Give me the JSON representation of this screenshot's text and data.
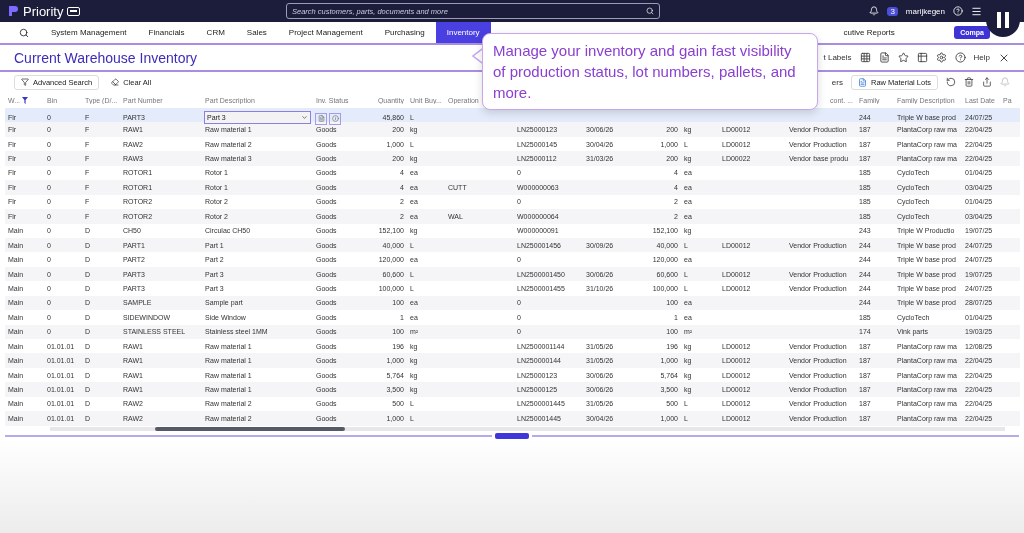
{
  "topbar": {
    "brand": "Priority",
    "search": {
      "placeholder": "Search customers, parts, documents and more"
    },
    "notifications": "3",
    "user": "marijkegen"
  },
  "nav": {
    "items": [
      {
        "label": "System Management",
        "selected": false
      },
      {
        "label": "Financials",
        "selected": false
      },
      {
        "label": "CRM",
        "selected": false
      },
      {
        "label": "Sales",
        "selected": false
      },
      {
        "label": "Project Management",
        "selected": false
      },
      {
        "label": "Purchasing",
        "selected": false
      },
      {
        "label": "Inventory",
        "selected": true
      }
    ],
    "trailing": "cutive Reports",
    "button": "Compa"
  },
  "form": {
    "title": "Current Warehouse Inventory",
    "labels_button": "t Labels",
    "help": "Help"
  },
  "filters": {
    "advanced_search": "Advanced Search",
    "clear_all": "Clear All",
    "partial_button": "ers",
    "lots_button": "Raw Material Lots"
  },
  "tooltip": {
    "text": "Manage your inventory and gain fast visibility of production status, lot numbers, pallets, and more."
  },
  "table": {
    "columns": [
      "W...",
      "Bin",
      "Type (D/...",
      "Part Number",
      "Part Description",
      "Inv. Status",
      "Quantity",
      "Unit Buy...",
      "Operation",
      null,
      null,
      null,
      null,
      null,
      "cont. ...",
      "Family",
      "Family Description",
      "Last Date",
      "Pa"
    ],
    "rows": [
      {
        "selected": true,
        "kind": "editing",
        "cells": [
          "Flr",
          "0",
          "F",
          "PART3",
          "Part 3",
          null,
          "45,860",
          "L",
          null,
          null,
          null,
          null,
          null,
          null,
          null,
          "244",
          "Triple W base prod",
          "24/07/25"
        ]
      },
      {
        "selected": false,
        "kind": "plain",
        "cells": [
          "Flr",
          "0",
          "F",
          "RAW1",
          "Raw material 1",
          "Goods",
          "200",
          "kg",
          null,
          "LN25000123",
          "30/06/26",
          "200",
          "kg",
          "LD00012",
          "Vendor Production",
          "187",
          "PlantaCorp raw ma",
          "22/04/25"
        ]
      },
      {
        "selected": false,
        "kind": "plain",
        "cells": [
          "Flr",
          "0",
          "F",
          "RAW2",
          "Raw material 2",
          "Goods",
          "1,000",
          "L",
          null,
          "LN25000145",
          "30/04/26",
          "1,000",
          "L",
          "LD00012",
          "Vendor Production",
          "187",
          "PlantaCorp raw ma",
          "22/04/25"
        ]
      },
      {
        "selected": false,
        "kind": "plain",
        "cells": [
          "Flr",
          "0",
          "F",
          "RAW3",
          "Raw material 3",
          "Goods",
          "200",
          "kg",
          null,
          "LN25000112",
          "31/03/26",
          "200",
          "kg",
          "LD00022",
          "Vendor base produ",
          "187",
          "PlantaCorp raw ma",
          "22/04/25"
        ]
      },
      {
        "selected": false,
        "kind": "plain",
        "cells": [
          "Flr",
          "0",
          "F",
          "ROTOR1",
          "Rotor 1",
          "Goods",
          "4",
          "ea",
          null,
          "0",
          null,
          "4",
          "ea",
          null,
          null,
          "185",
          "CycloTech",
          "01/04/25"
        ]
      },
      {
        "selected": false,
        "kind": "plain",
        "cells": [
          "Flr",
          "0",
          "F",
          "ROTOR1",
          "Rotor 1",
          "Goods",
          "4",
          "ea",
          "CUTT",
          "W000000063",
          null,
          "4",
          "ea",
          null,
          null,
          "185",
          "CycloTech",
          "03/04/25"
        ]
      },
      {
        "selected": false,
        "kind": "plain",
        "cells": [
          "Flr",
          "0",
          "F",
          "ROTOR2",
          "Rotor 2",
          "Goods",
          "2",
          "ea",
          null,
          "0",
          null,
          "2",
          "ea",
          null,
          null,
          "185",
          "CycloTech",
          "01/04/25"
        ]
      },
      {
        "selected": false,
        "kind": "plain",
        "cells": [
          "Flr",
          "0",
          "F",
          "ROTOR2",
          "Rotor 2",
          "Goods",
          "2",
          "ea",
          "WAL",
          "W000000064",
          null,
          "2",
          "ea",
          null,
          null,
          "185",
          "CycloTech",
          "03/04/25"
        ]
      },
      {
        "selected": false,
        "kind": "plain",
        "cells": [
          "Main",
          "0",
          "D",
          "CH50",
          "Circulac CH50",
          "Goods",
          "152,100",
          "kg",
          null,
          "W000000091",
          null,
          "152,100",
          "kg",
          null,
          null,
          "243",
          "Triple W Productio",
          "19/07/25"
        ]
      },
      {
        "selected": false,
        "kind": "plain",
        "cells": [
          "Main",
          "0",
          "D",
          "PART1",
          "Part 1",
          "Goods",
          "40,000",
          "L",
          null,
          "LN250001456",
          "30/09/26",
          "40,000",
          "L",
          "LD00012",
          "Vendor Production",
          "244",
          "Triple W base prod",
          "24/07/25"
        ]
      },
      {
        "selected": false,
        "kind": "plain",
        "cells": [
          "Main",
          "0",
          "D",
          "PART2",
          "Part 2",
          "Goods",
          "120,000",
          "ea",
          null,
          "0",
          null,
          "120,000",
          "ea",
          null,
          null,
          "244",
          "Triple W base prod",
          "24/07/25"
        ]
      },
      {
        "selected": false,
        "kind": "plain",
        "cells": [
          "Main",
          "0",
          "D",
          "PART3",
          "Part 3",
          "Goods",
          "60,600",
          "L",
          null,
          "LN2500001450",
          "30/06/26",
          "60,600",
          "L",
          "LD00012",
          "Vendor Production",
          "244",
          "Triple W base prod",
          "19/07/25"
        ]
      },
      {
        "selected": false,
        "kind": "plain",
        "cells": [
          "Main",
          "0",
          "D",
          "PART3",
          "Part 3",
          "Goods",
          "100,000",
          "L",
          null,
          "LN2500001455",
          "31/10/26",
          "100,000",
          "L",
          "LD00012",
          "Vendor Production",
          "244",
          "Triple W base prod",
          "24/07/25"
        ]
      },
      {
        "selected": false,
        "kind": "plain",
        "cells": [
          "Main",
          "0",
          "D",
          "SAMPLE",
          "Sample part",
          "Goods",
          "100",
          "ea",
          null,
          "0",
          null,
          "100",
          "ea",
          null,
          null,
          "244",
          "Triple W base prod",
          "28/07/25"
        ]
      },
      {
        "selected": false,
        "kind": "plain",
        "cells": [
          "Main",
          "0",
          "D",
          "SIDEWINDOW",
          "Side Window",
          "Goods",
          "1",
          "ea",
          null,
          "0",
          null,
          "1",
          "ea",
          null,
          null,
          "185",
          "CycloTech",
          "01/04/25"
        ]
      },
      {
        "selected": false,
        "kind": "plain",
        "cells": [
          "Main",
          "0",
          "D",
          "STAINLESS STEEL",
          "Stainless steel 1MM",
          "Goods",
          "100",
          "m²",
          null,
          "0",
          null,
          "100",
          "m²",
          null,
          null,
          "174",
          "Vink parts",
          "19/03/25"
        ]
      },
      {
        "selected": false,
        "kind": "plain",
        "cells": [
          "Main",
          "01.01.01",
          "D",
          "RAW1",
          "Raw material 1",
          "Goods",
          "196",
          "kg",
          null,
          "LN2500001144",
          "31/05/26",
          "196",
          "kg",
          "LD00012",
          "Vendor Production",
          "187",
          "PlantaCorp raw ma",
          "12/08/25"
        ]
      },
      {
        "selected": false,
        "kind": "plain",
        "cells": [
          "Main",
          "01.01.01",
          "D",
          "RAW1",
          "Raw material 1",
          "Goods",
          "1,000",
          "kg",
          null,
          "LN250000144",
          "31/05/26",
          "1,000",
          "kg",
          "LD00012",
          "Vendor Production",
          "187",
          "PlantaCorp raw ma",
          "22/04/25"
        ]
      },
      {
        "selected": false,
        "kind": "plain",
        "cells": [
          "Main",
          "01.01.01",
          "D",
          "RAW1",
          "Raw material 1",
          "Goods",
          "5,764",
          "kg",
          null,
          "LN25000123",
          "30/06/26",
          "5,764",
          "kg",
          "LD00012",
          "Vendor Production",
          "187",
          "PlantaCorp raw ma",
          "22/04/25"
        ]
      },
      {
        "selected": false,
        "kind": "plain",
        "cells": [
          "Main",
          "01.01.01",
          "D",
          "RAW1",
          "Raw material 1",
          "Goods",
          "3,500",
          "kg",
          null,
          "LN25000125",
          "30/06/26",
          "3,500",
          "kg",
          "LD00012",
          "Vendor Production",
          "187",
          "PlantaCorp raw ma",
          "22/04/25"
        ]
      },
      {
        "selected": false,
        "kind": "plain",
        "cells": [
          "Main",
          "01.01.01",
          "D",
          "RAW2",
          "Raw material 2",
          "Goods",
          "500",
          "L",
          null,
          "LN2500001445",
          "31/05/26",
          "500",
          "L",
          "LD00012",
          "Vendor Production",
          "187",
          "PlantaCorp raw ma",
          "22/04/25"
        ]
      },
      {
        "selected": false,
        "kind": "plain",
        "cells": [
          "Main",
          "01.01.01",
          "D",
          "RAW2",
          "Raw material 2",
          "Goods",
          "1,000",
          "L",
          null,
          "LN250001445",
          "30/04/26",
          "1,000",
          "L",
          "LD00012",
          "Vendor Production",
          "187",
          "PlantaCorp raw ma",
          "22/04/25"
        ]
      }
    ]
  }
}
